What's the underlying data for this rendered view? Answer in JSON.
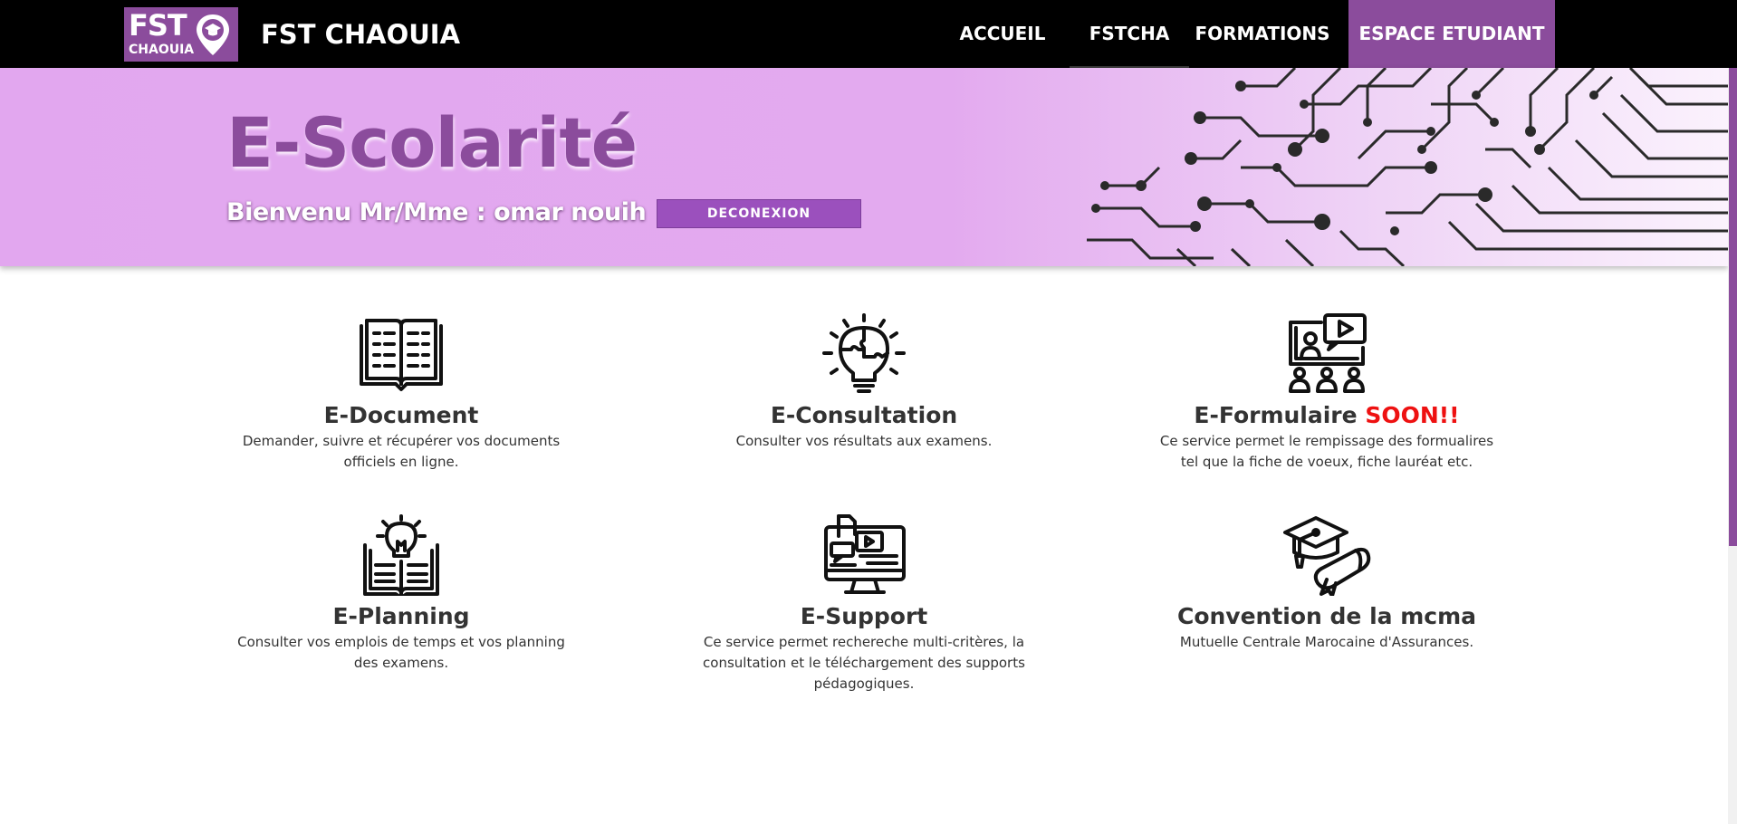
{
  "header": {
    "logo": {
      "line1": "FST",
      "line2": "CHAOUIA"
    },
    "brand": "FST CHAOUIA",
    "nav": [
      {
        "label": "ACCUEIL"
      },
      {
        "label": "FSTCHA"
      },
      {
        "label": "FORMATIONS"
      },
      {
        "label": "ESPACE ETUDIANT",
        "active": true
      }
    ]
  },
  "hero": {
    "title": "E-Scolarité",
    "welcome": "Bienvenu Mr/Mme : omar nouih",
    "logout_label": "DECONEXION"
  },
  "services": [
    {
      "title": "E-Document",
      "icon": "open-book-icon",
      "description": "Demander, suivre et récupérer vos documents officiels en ligne."
    },
    {
      "title": "E-Consultation",
      "icon": "lightbulb-puzzle-icon",
      "description": "Consulter vos résultats aux examens."
    },
    {
      "title": "E-Formulaire",
      "badge": "SOON!!",
      "icon": "video-presentation-icon",
      "description": "Ce service permet le rempissage des formualires tel que la fiche de voeux, fiche lauréat etc."
    },
    {
      "title": "E-Planning",
      "icon": "book-idea-icon",
      "description": "Consulter vos emplois de temps et vos planning des examens."
    },
    {
      "title": "E-Support",
      "icon": "monitor-media-icon",
      "description": "Ce service permet rechereche multi-critères, la consultation et le téléchargement des supports pédagogiques."
    },
    {
      "title": "Convention de la mcma",
      "icon": "graduation-cap-diploma-icon",
      "description": "Mutuelle Centrale Marocaine d'Assurances."
    }
  ],
  "colors": {
    "brand": "#8b4c9c",
    "nav_bg": "#000000",
    "hero_bg": "#e2a7ef",
    "soon": "#ee1111",
    "button": "#9b50bd"
  }
}
